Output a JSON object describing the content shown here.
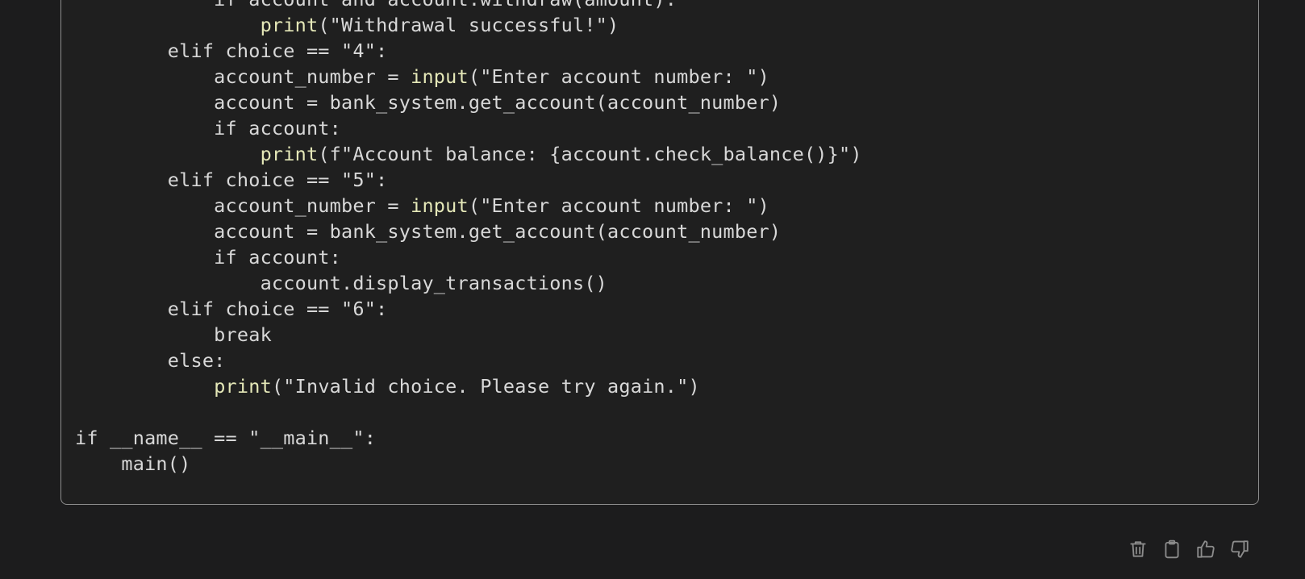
{
  "code_block": {
    "lines": [
      {
        "segments": [
          {
            "t": "            if account and account.withdraw(amount):",
            "c": "plain"
          }
        ]
      },
      {
        "segments": [
          {
            "t": "                ",
            "c": "plain"
          },
          {
            "t": "print",
            "c": "fn"
          },
          {
            "t": "(\"Withdrawal successful!\")",
            "c": "plain"
          }
        ]
      },
      {
        "segments": [
          {
            "t": "        elif choice == \"4\":",
            "c": "plain"
          }
        ]
      },
      {
        "segments": [
          {
            "t": "            account_number = ",
            "c": "plain"
          },
          {
            "t": "input",
            "c": "fn"
          },
          {
            "t": "(\"Enter account number: \")",
            "c": "plain"
          }
        ]
      },
      {
        "segments": [
          {
            "t": "            account = bank_system.get_account(account_number)",
            "c": "plain"
          }
        ]
      },
      {
        "segments": [
          {
            "t": "            if account:",
            "c": "plain"
          }
        ]
      },
      {
        "segments": [
          {
            "t": "                ",
            "c": "plain"
          },
          {
            "t": "print",
            "c": "fn"
          },
          {
            "t": "(f\"Account balance: {account.check_balance()}\")",
            "c": "plain"
          }
        ]
      },
      {
        "segments": [
          {
            "t": "        elif choice == \"5\":",
            "c": "plain"
          }
        ]
      },
      {
        "segments": [
          {
            "t": "            account_number = ",
            "c": "plain"
          },
          {
            "t": "input",
            "c": "fn"
          },
          {
            "t": "(\"Enter account number: \")",
            "c": "plain"
          }
        ]
      },
      {
        "segments": [
          {
            "t": "            account = bank_system.get_account(account_number)",
            "c": "plain"
          }
        ]
      },
      {
        "segments": [
          {
            "t": "            if account:",
            "c": "plain"
          }
        ]
      },
      {
        "segments": [
          {
            "t": "                account.display_transactions()",
            "c": "plain"
          }
        ]
      },
      {
        "segments": [
          {
            "t": "        elif choice == \"6\":",
            "c": "plain"
          }
        ]
      },
      {
        "segments": [
          {
            "t": "            break",
            "c": "plain"
          }
        ]
      },
      {
        "segments": [
          {
            "t": "        else:",
            "c": "plain"
          }
        ]
      },
      {
        "segments": [
          {
            "t": "            ",
            "c": "plain"
          },
          {
            "t": "print",
            "c": "fn"
          },
          {
            "t": "(\"Invalid choice. Please try again.\")",
            "c": "plain"
          }
        ]
      },
      {
        "segments": [
          {
            "t": "",
            "c": "plain"
          }
        ]
      },
      {
        "segments": [
          {
            "t": "if __name__ == \"__main__\":",
            "c": "plain"
          }
        ]
      },
      {
        "segments": [
          {
            "t": "    main()",
            "c": "plain"
          }
        ]
      }
    ]
  },
  "actions": [
    {
      "name": "delete-button",
      "icon": "trash-icon"
    },
    {
      "name": "copy-button",
      "icon": "clipboard-icon"
    },
    {
      "name": "thumbs-up-button",
      "icon": "thumbs-up-icon"
    },
    {
      "name": "thumbs-down-button",
      "icon": "thumbs-down-icon"
    }
  ],
  "colors": {
    "page_background": "#1c1c1d",
    "code_background": "#1f1f1f",
    "code_border": "#8e8e8e",
    "code_text": "#d8d8d8",
    "builtin_function": "#e5e8b8",
    "icon": "#8c8c8c"
  }
}
